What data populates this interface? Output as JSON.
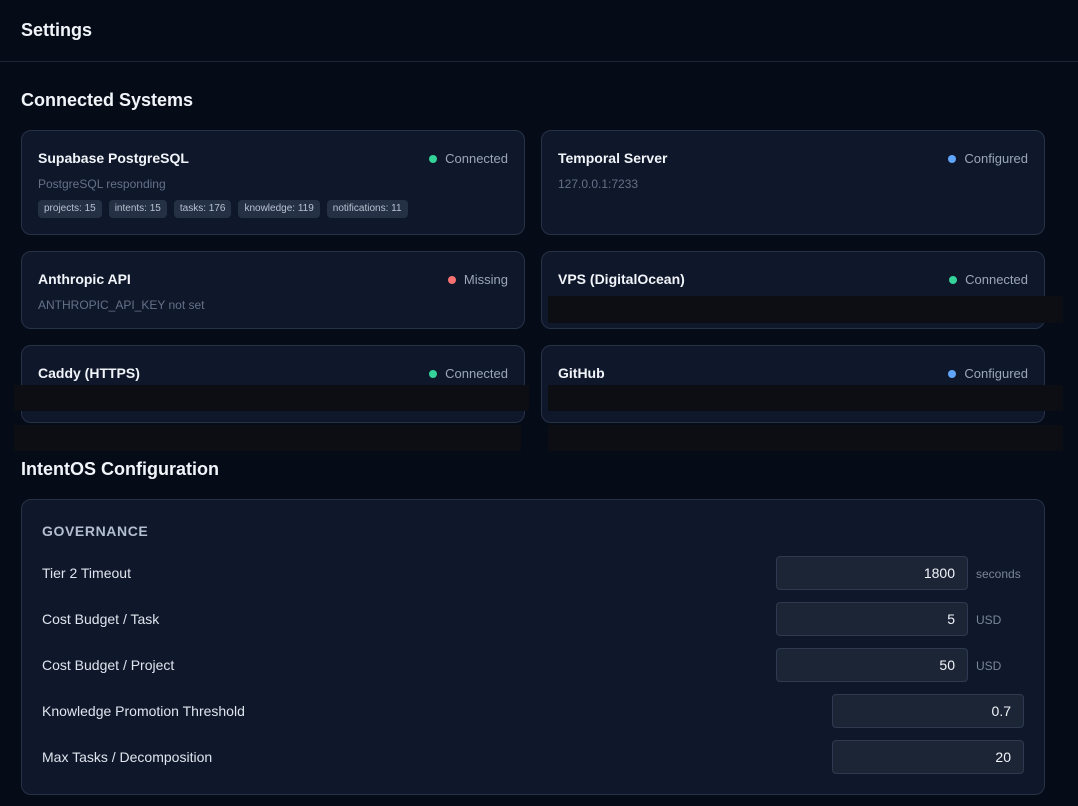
{
  "header": {
    "title": "Settings"
  },
  "connected_systems": {
    "title": "Connected Systems",
    "cards": [
      {
        "name": "Supabase PostgreSQL",
        "status": "Connected",
        "status_color": "#34d399",
        "subtitle": "PostgreSQL responding",
        "chips": [
          "projects: 15",
          "intents: 15",
          "tasks: 176",
          "knowledge: 119",
          "notifications: 11"
        ]
      },
      {
        "name": "Temporal Server",
        "status": "Configured",
        "status_color": "#60a5fa",
        "subtitle": "127.0.0.1:7233"
      },
      {
        "name": "Anthropic API",
        "status": "Missing",
        "status_color": "#f87171",
        "subtitle": "ANTHROPIC_API_KEY not set"
      },
      {
        "name": "VPS (DigitalOcean)",
        "status": "Connected",
        "status_color": "#34d399"
      },
      {
        "name": "Caddy (HTTPS)",
        "status": "Connected",
        "status_color": "#34d399"
      },
      {
        "name": "GitHub",
        "status": "Configured",
        "status_color": "#60a5fa"
      }
    ]
  },
  "configuration": {
    "title": "IntentOS Configuration",
    "group_title": "GOVERNANCE",
    "fields": [
      {
        "label": "Tier 2 Timeout",
        "value": "1800",
        "unit": "seconds"
      },
      {
        "label": "Cost Budget / Task",
        "value": "5",
        "unit": "USD"
      },
      {
        "label": "Cost Budget / Project",
        "value": "50",
        "unit": "USD"
      },
      {
        "label": "Knowledge Promotion Threshold",
        "value": "0.7"
      },
      {
        "label": "Max Tasks / Decomposition",
        "value": "20"
      }
    ]
  }
}
